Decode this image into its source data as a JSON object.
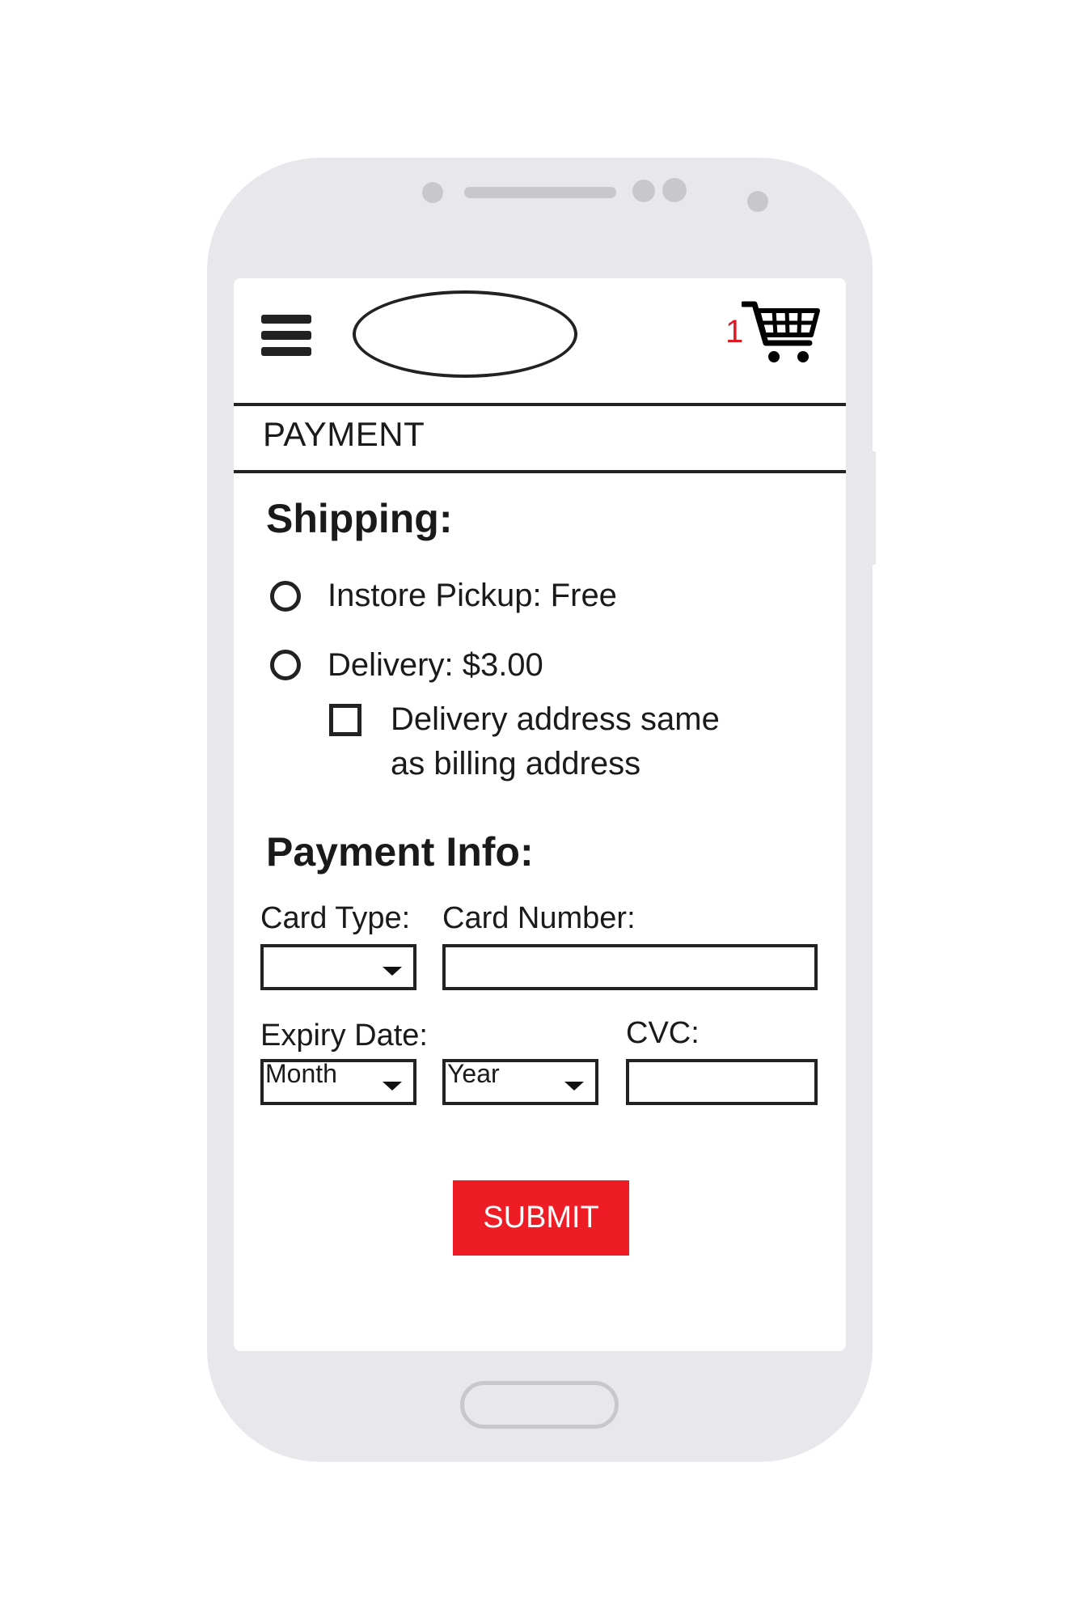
{
  "header": {
    "cart_count": "1"
  },
  "page_title": "PAYMENT",
  "shipping": {
    "heading": "Shipping:",
    "options": [
      {
        "label": "Instore Pickup: Free"
      },
      {
        "label": "Delivery: $3.00"
      }
    ],
    "same_address_line1": "Delivery address same",
    "same_address_line2": "as billing address"
  },
  "payment": {
    "heading": "Payment Info:",
    "card_type_label": "Card Type:",
    "card_type_value": "",
    "card_number_label": "Card Number:",
    "card_number_value": "",
    "expiry_label": "Expiry Date:",
    "month_value": "Month",
    "year_value": "Year",
    "cvc_label": "CVC:",
    "cvc_value": ""
  },
  "submit_label": "SUBMIT",
  "colors": {
    "accent": "#ee1c25",
    "cart_count": "#e01b24",
    "phone_body": "#e8e8ec"
  },
  "icons": [
    "hamburger-menu-icon",
    "cart-icon"
  ]
}
